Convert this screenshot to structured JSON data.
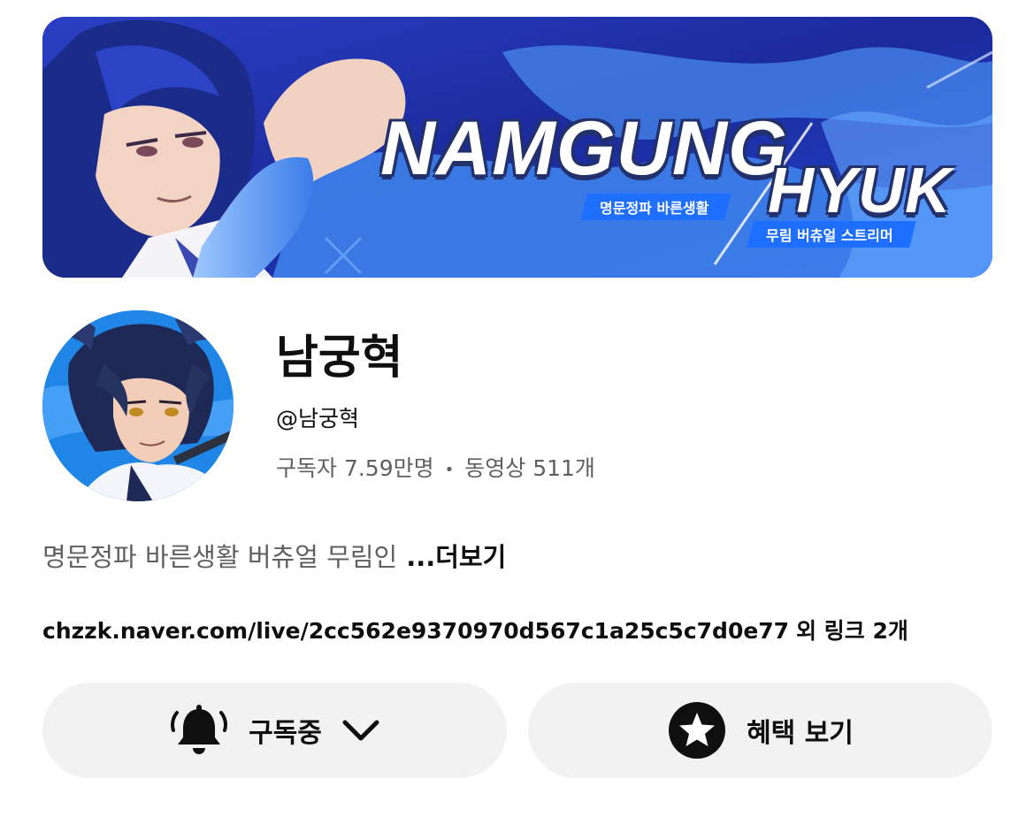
{
  "banner": {
    "title_line1": "NAMGUNG",
    "title_line2": "HYUK",
    "tag_1": "명문정파 바른생활",
    "tag_2": "무림 버츄얼 스트리머"
  },
  "channel": {
    "name": "남궁혁",
    "handle": "@남궁혁",
    "subscribers": "구독자 7.59만명",
    "separator": "•",
    "videos": "동영상 511개",
    "description": "명문정파 바른생활 버츄얼 무림인",
    "more_label": "...더보기",
    "link_url": "chzzk.naver.com/live/2cc562e9370970d567c1a25c5c7d0e77",
    "link_extra": "외 링크 2개"
  },
  "buttons": {
    "subscribe_label": "구독중",
    "subscribe_icon": "bell-ringing-icon",
    "dropdown_icon": "chevron-down-icon",
    "benefits_label": "혜택 보기",
    "benefits_icon": "star-circle-icon"
  },
  "colors": {
    "banner_blue": "#1d2fa8",
    "tag_blue": "#1e6fff",
    "avatar_blue": "#1f86e8",
    "button_bg": "#f2f2f2",
    "secondary_text": "#606060",
    "primary_text": "#0f0f0f"
  }
}
